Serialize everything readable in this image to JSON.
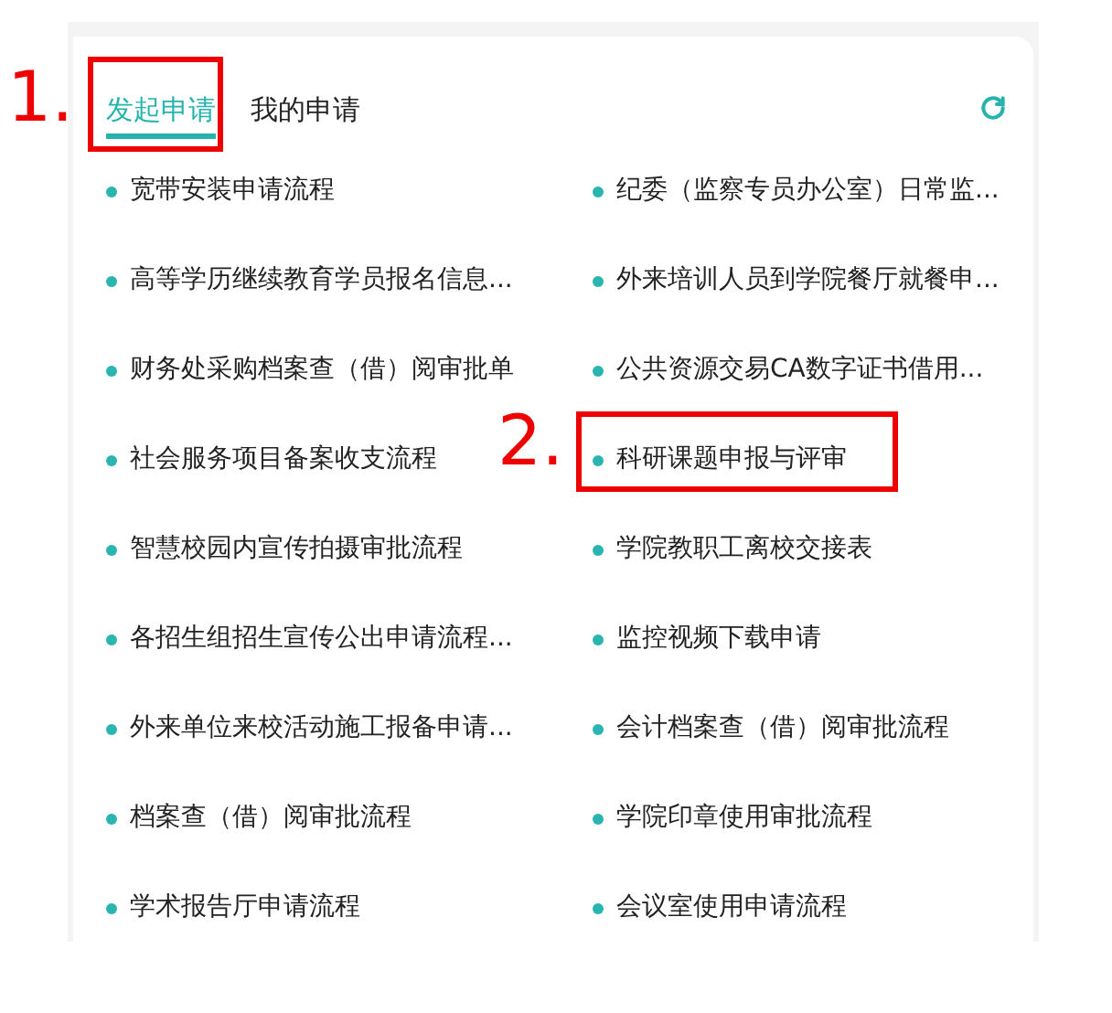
{
  "tabs": [
    {
      "label": "发起申请",
      "selected": true
    },
    {
      "label": "我的申请",
      "selected": false
    }
  ],
  "items": [
    "宽带安装申请流程",
    "纪委（监察专员办公室）日常监...",
    "高等学历继续教育学员报名信息...",
    "外来培训人员到学院餐厅就餐申...",
    "财务处采购档案查（借）阅审批单",
    "公共资源交易CA数字证书借用...",
    "社会服务项目备案收支流程",
    "科研课题申报与评审",
    "智慧校园内宣传拍摄审批流程",
    "学院教职工离校交接表",
    "各招生组招生宣传公出申请流程...",
    "监控视频下载申请",
    "外来单位来校活动施工报备申请...",
    "会计档案查（借）阅审批流程",
    "档案查（借）阅审批流程",
    "学院印章使用审批流程",
    "学术报告厅申请流程",
    "会议室使用申请流程"
  ],
  "annotations": [
    {
      "label": "1."
    },
    {
      "label": "2."
    }
  ]
}
